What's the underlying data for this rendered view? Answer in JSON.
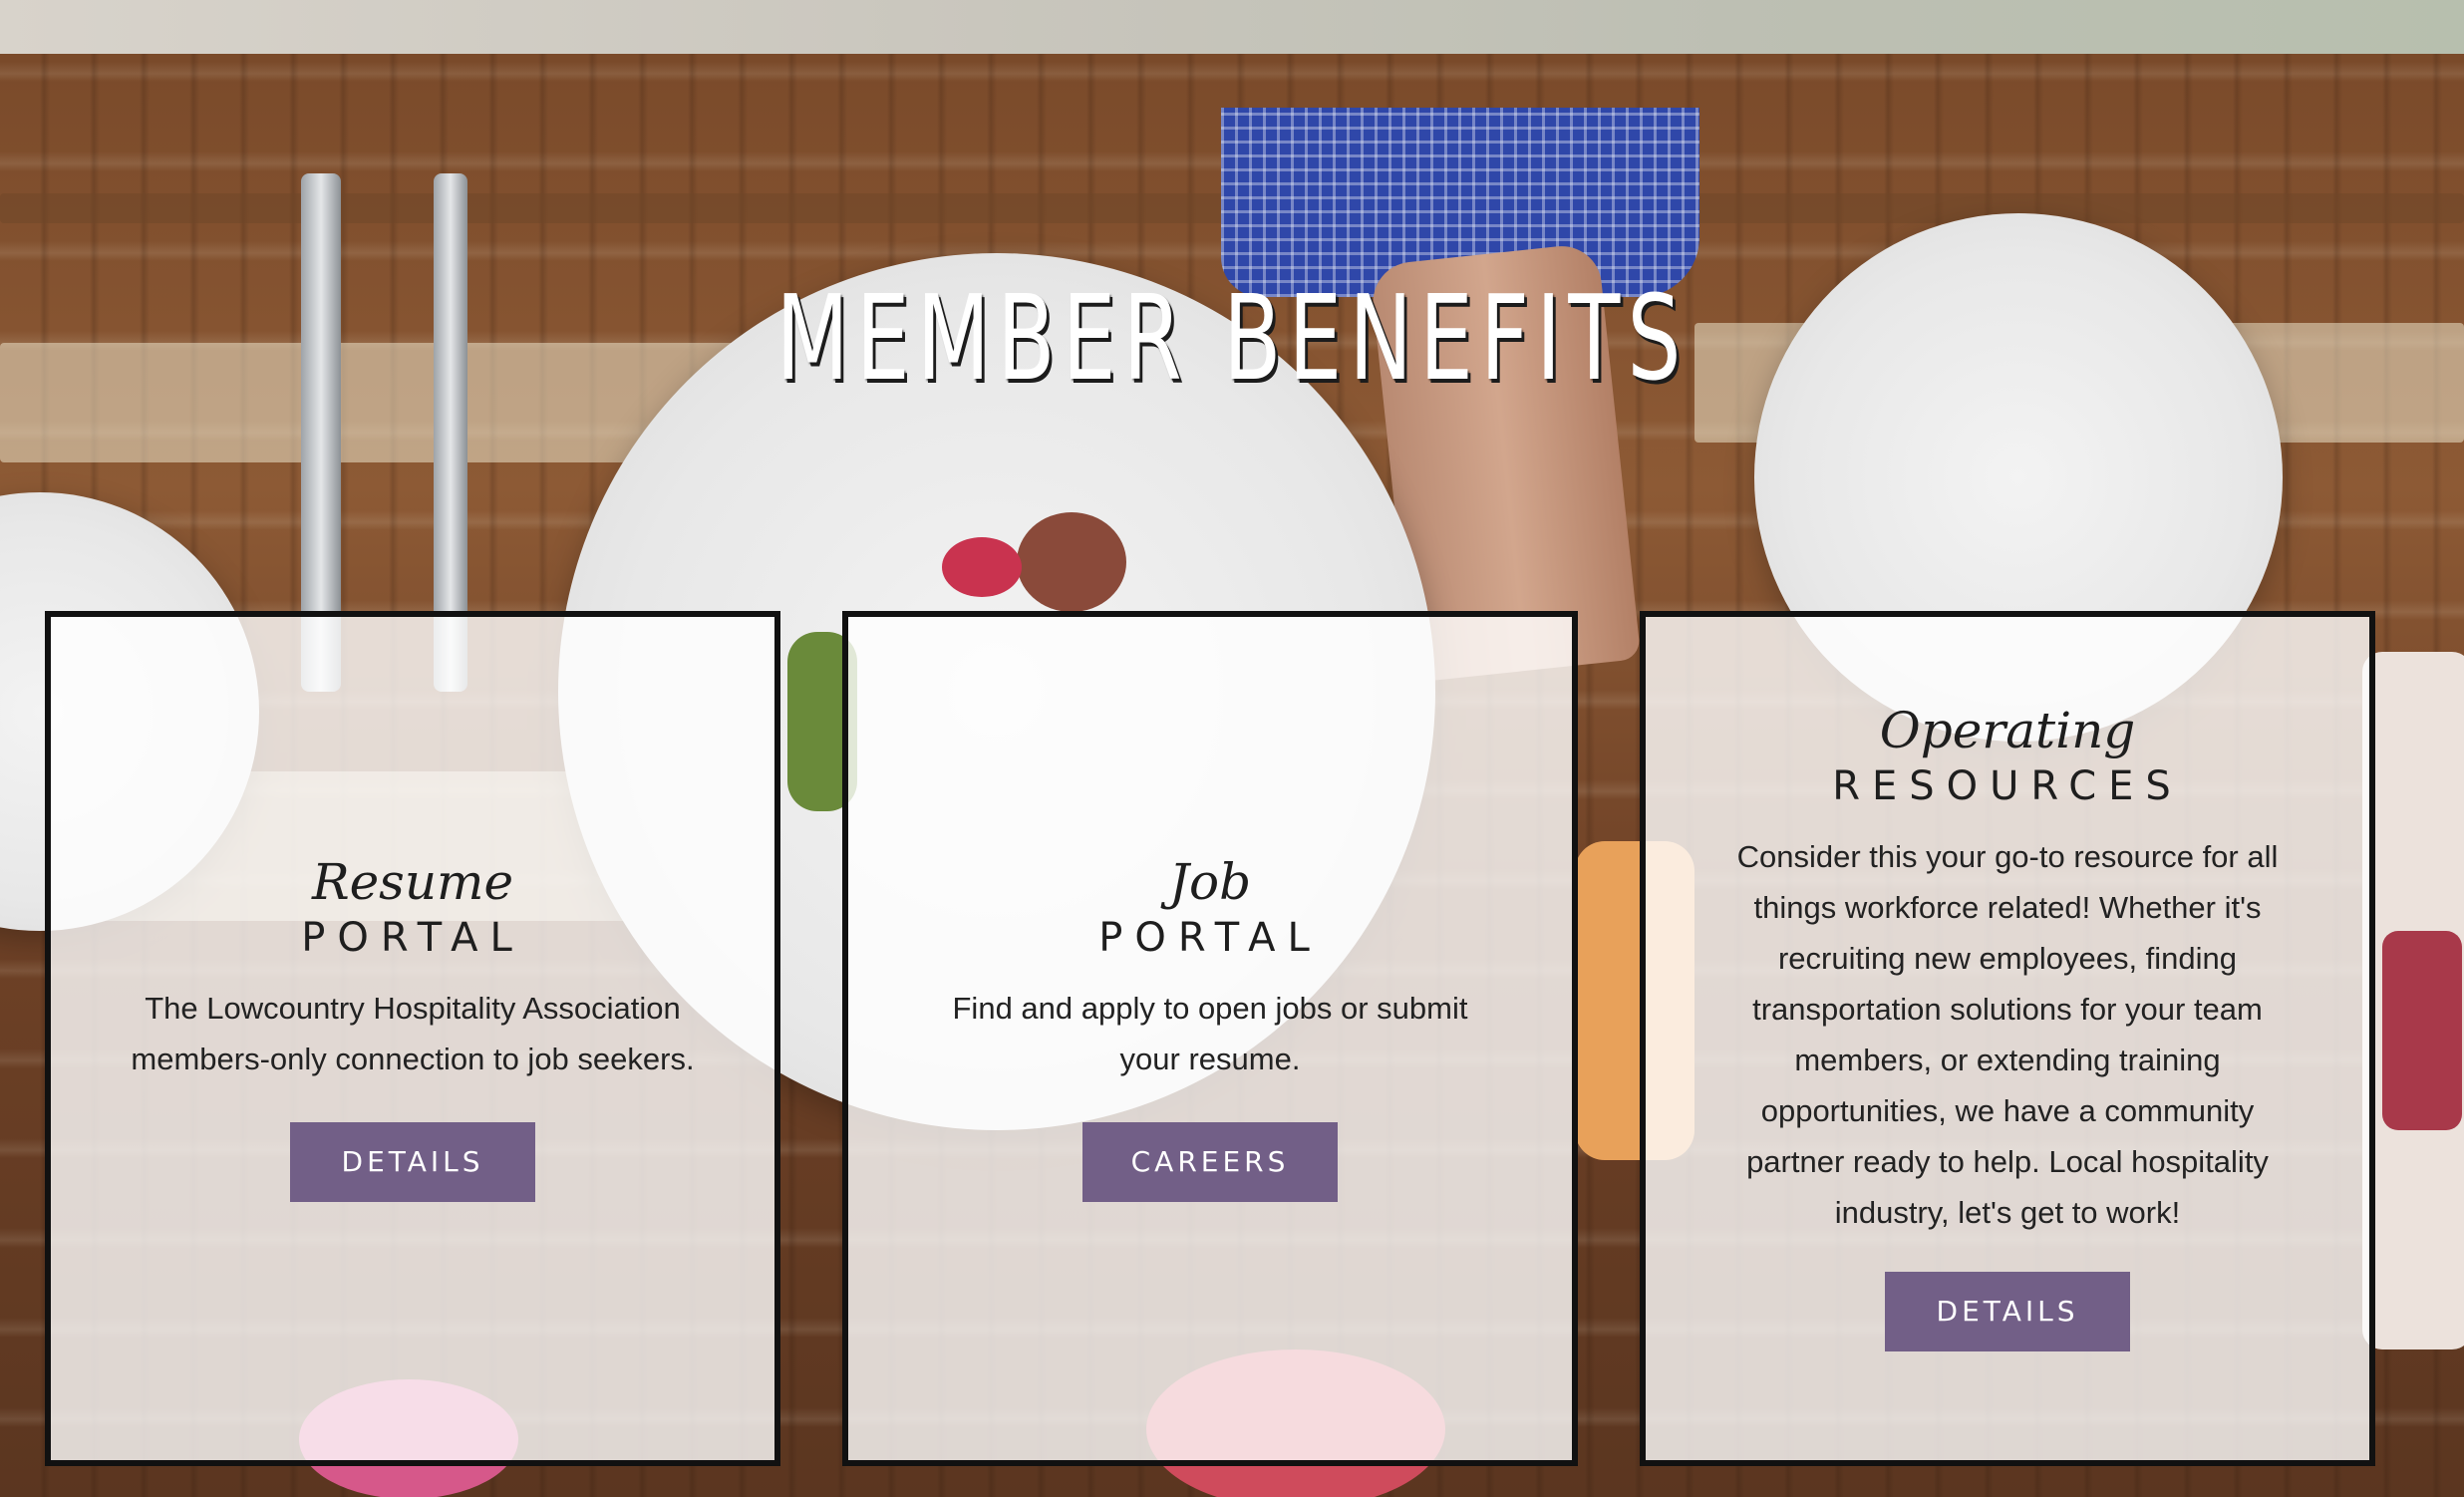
{
  "section": {
    "title": "MEMBER BENEFITS"
  },
  "cards": [
    {
      "italic": "Resume",
      "caps": "PORTAL",
      "text": "The Lowcountry Hospitality Association members-only connection to job seekers.",
      "button": "DETAILS"
    },
    {
      "italic": "Job",
      "caps": "PORTAL",
      "text": "Find and apply to open jobs or submit your resume.",
      "button": "CAREERS"
    },
    {
      "italic": "Operating",
      "caps": "RESOURCES",
      "text": "Consider this your go-to resource for all things workforce related! Whether it's recruiting new employees, finding transportation solutions for your team members, or extending training opportunities, we have a community partner ready to help. Local hospitality industry, let's get to work!",
      "button": "DETAILS"
    }
  ],
  "colors": {
    "button_bg": "#725f87",
    "button_text": "#ffffff",
    "card_border": "#111111",
    "title_text": "#ffffff"
  }
}
